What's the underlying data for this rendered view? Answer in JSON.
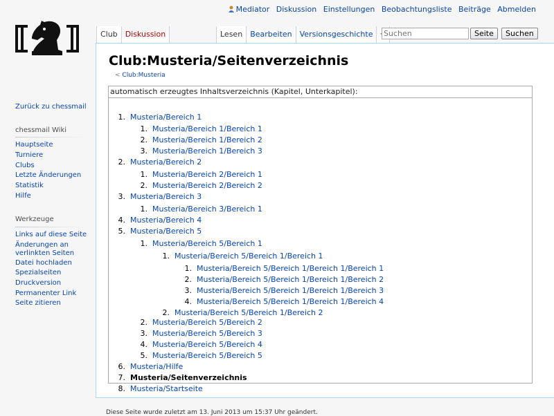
{
  "personal": {
    "items": [
      {
        "label": "Mediator",
        "icon": "user-icon"
      },
      {
        "label": "Diskussion"
      },
      {
        "label": "Einstellungen"
      },
      {
        "label": "Beobachtungsliste"
      },
      {
        "label": "Beiträge"
      },
      {
        "label": "Abmelden"
      }
    ]
  },
  "tabs": {
    "left": [
      {
        "label": "Club",
        "selected": true
      },
      {
        "label": "Diskussion",
        "new": true
      }
    ],
    "right": [
      {
        "label": "Lesen",
        "selected": true
      },
      {
        "label": "Bearbeiten"
      },
      {
        "label": "Versionsgeschichte"
      }
    ],
    "more_icon": "chevron-down-icon"
  },
  "search": {
    "placeholder": "Suchen",
    "go_label": "Seite",
    "search_label": "Suchen"
  },
  "page": {
    "title": "Club:Musteria/Seitenverzeichnis",
    "breadcrumb_prefix": "<",
    "breadcrumb_link": "Club:Musteria"
  },
  "toc": {
    "heading": "automatisch erzeugtes Inhaltsverzeichnis (Kapitel, Unterkapitel):",
    "items": [
      {
        "num": "1.",
        "label": "Musteria/Bereich 1",
        "level": 0
      },
      {
        "num": "1.",
        "label": "Musteria/Bereich 1/Bereich 1",
        "level": 1
      },
      {
        "num": "2.",
        "label": "Musteria/Bereich 1/Bereich 2",
        "level": 1
      },
      {
        "num": "3.",
        "label": "Musteria/Bereich 1/Bereich 3",
        "level": 1
      },
      {
        "num": "2.",
        "label": "Musteria/Bereich 2",
        "level": 0
      },
      {
        "num": "1.",
        "label": "Musteria/Bereich 2/Bereich 1",
        "level": 1
      },
      {
        "num": "2.",
        "label": "Musteria/Bereich 2/Bereich 2",
        "level": 1
      },
      {
        "num": "3.",
        "label": "Musteria/Bereich 3",
        "level": 0
      },
      {
        "num": "1.",
        "label": "Musteria/Bereich 3/Bereich 1",
        "level": 1
      },
      {
        "num": "4.",
        "label": "Musteria/Bereich 4",
        "level": 0
      },
      {
        "num": "5.",
        "label": "Musteria/Bereich 5",
        "level": 0
      },
      {
        "num": "1.",
        "label": "Musteria/Bereich 5/Bereich 1",
        "level": 1
      },
      {
        "num": "1.",
        "label": "Musteria/Bereich 5/Bereich 1/Bereich 1",
        "level": 2
      },
      {
        "num": "1.",
        "label": "Musteria/Bereich 5/Bereich 1/Bereich 1/Bereich 1",
        "level": 3
      },
      {
        "num": "2.",
        "label": "Musteria/Bereich 5/Bereich 1/Bereich 1/Bereich 2",
        "level": 3
      },
      {
        "num": "3.",
        "label": "Musteria/Bereich 5/Bereich 1/Bereich 1/Bereich 3",
        "level": 3
      },
      {
        "num": "4.",
        "label": "Musteria/Bereich 5/Bereich 1/Bereich 1/Bereich 4",
        "level": 3
      },
      {
        "num": "2.",
        "label": "Musteria/Bereich 5/Bereich 1/Bereich 2",
        "level": 2
      },
      {
        "num": "2.",
        "label": "Musteria/Bereich 5/Bereich 2",
        "level": 1
      },
      {
        "num": "3.",
        "label": "Musteria/Bereich 5/Bereich 3",
        "level": 1
      },
      {
        "num": "4.",
        "label": "Musteria/Bereich 5/Bereich 4",
        "level": 1
      },
      {
        "num": "5.",
        "label": "Musteria/Bereich 5/Bereich 5",
        "level": 1
      },
      {
        "num": "6.",
        "label": "Musteria/Hilfe",
        "level": 0
      },
      {
        "num": "7.",
        "label": "Musteria/Seitenverzeichnis",
        "level": 0,
        "current": true
      },
      {
        "num": "8.",
        "label": "Musteria/Startseite",
        "level": 0
      }
    ]
  },
  "sidebar": {
    "back_link": "Zurück zu chessmail",
    "wiki_heading": "chessmail Wiki",
    "wiki_links": [
      "Hauptseite",
      "Turniere",
      "Clubs",
      "Letzte Änderungen",
      "Statistik",
      "Hilfe"
    ],
    "tools_heading": "Werkzeuge",
    "tools_links": [
      {
        "line1": "Links auf diese Seite"
      },
      {
        "line1": "Änderungen an",
        "line2": "verlinkten Seiten"
      },
      {
        "line1": "Datei hochladen"
      },
      {
        "line1": "Spezialseiten"
      },
      {
        "line1": "Druckversion"
      },
      {
        "line1": "Permanenter Link"
      },
      {
        "line1": "Seite zitieren"
      }
    ]
  },
  "footer": {
    "text": "Diese Seite wurde zuletzt am 13. Juni 2013 um 15:37 Uhr geändert."
  },
  "colors": {
    "link": "#0645ad",
    "new_link": "#ba0000",
    "border": "#a7d7f9"
  }
}
